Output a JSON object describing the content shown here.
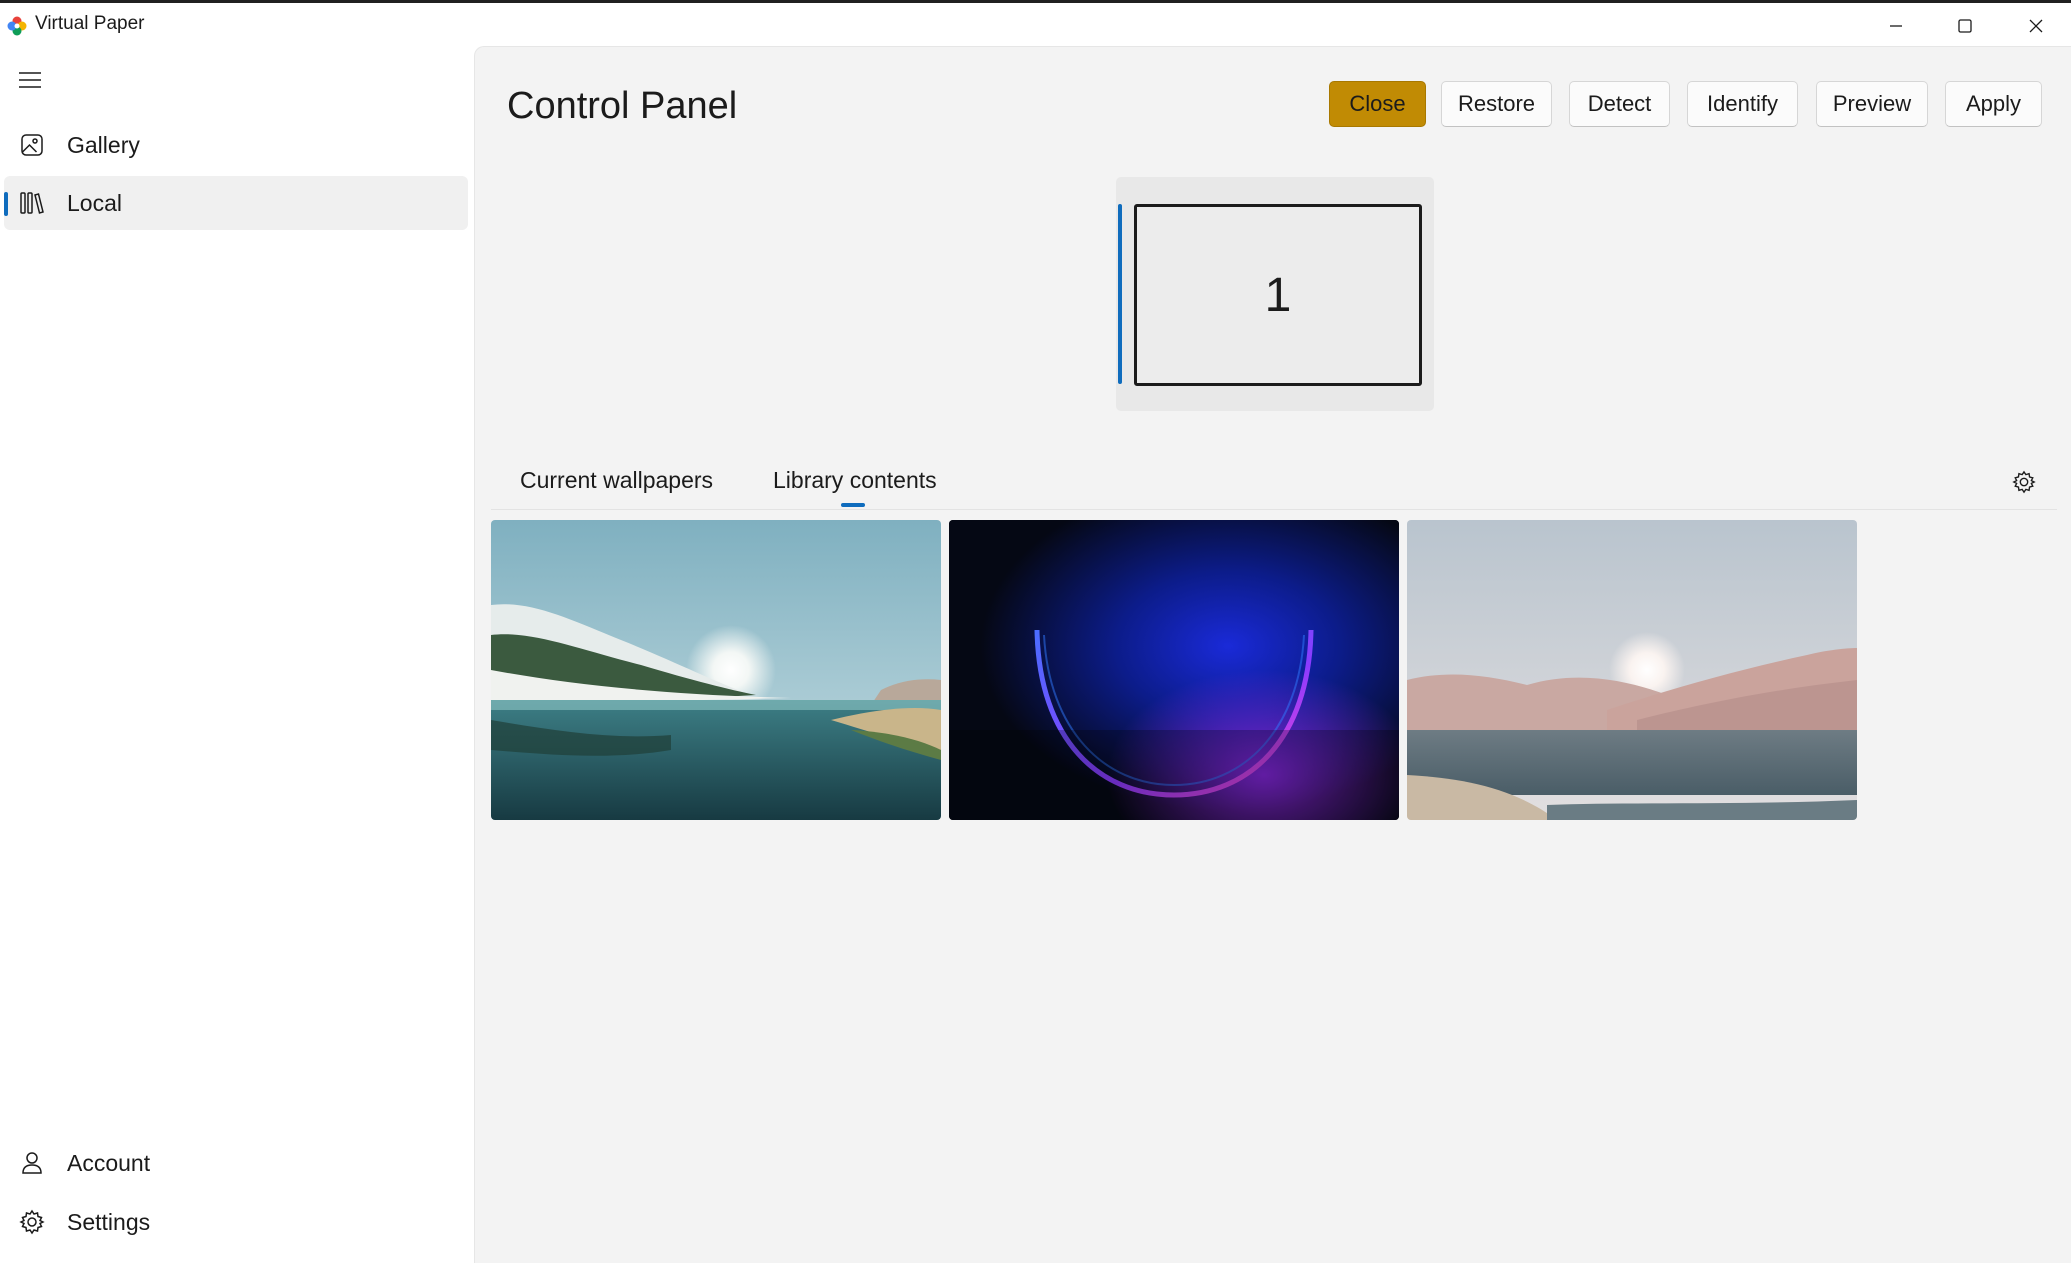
{
  "window": {
    "title": "Virtual Paper",
    "controls": [
      "minimize-icon",
      "maximize-icon",
      "close-icon"
    ]
  },
  "nav": {
    "menu_icon": "hamburger-icon",
    "items": [
      {
        "label": "Gallery",
        "icon": "image-icon",
        "selected": false
      },
      {
        "label": "Local",
        "icon": "library-icon",
        "selected": true
      }
    ],
    "footer_items": [
      {
        "label": "Account",
        "icon": "person-icon"
      },
      {
        "label": "Settings",
        "icon": "gear-icon"
      }
    ]
  },
  "content": {
    "title": "Control Panel",
    "toolbar": {
      "close_label": "Close",
      "restore_label": "Restore",
      "detect_label": "Detect",
      "identify_label": "Identify",
      "preview_label": "Preview",
      "apply_label": "Apply"
    },
    "monitor": {
      "number": "1",
      "selected": true
    },
    "tabs": [
      {
        "label": "Current wallpapers",
        "selected": false
      },
      {
        "label": "Library contents",
        "selected": true
      }
    ],
    "tab_settings_icon": "gear-icon",
    "wallpapers": [
      {
        "theme": "lake-landscape"
      },
      {
        "theme": "dark-bloom"
      },
      {
        "theme": "desert-lake"
      }
    ]
  },
  "colors": {
    "accent_button": "#c18b04",
    "selection_indicator": "#0f6cbd",
    "content_background": "#f3f3f3"
  }
}
